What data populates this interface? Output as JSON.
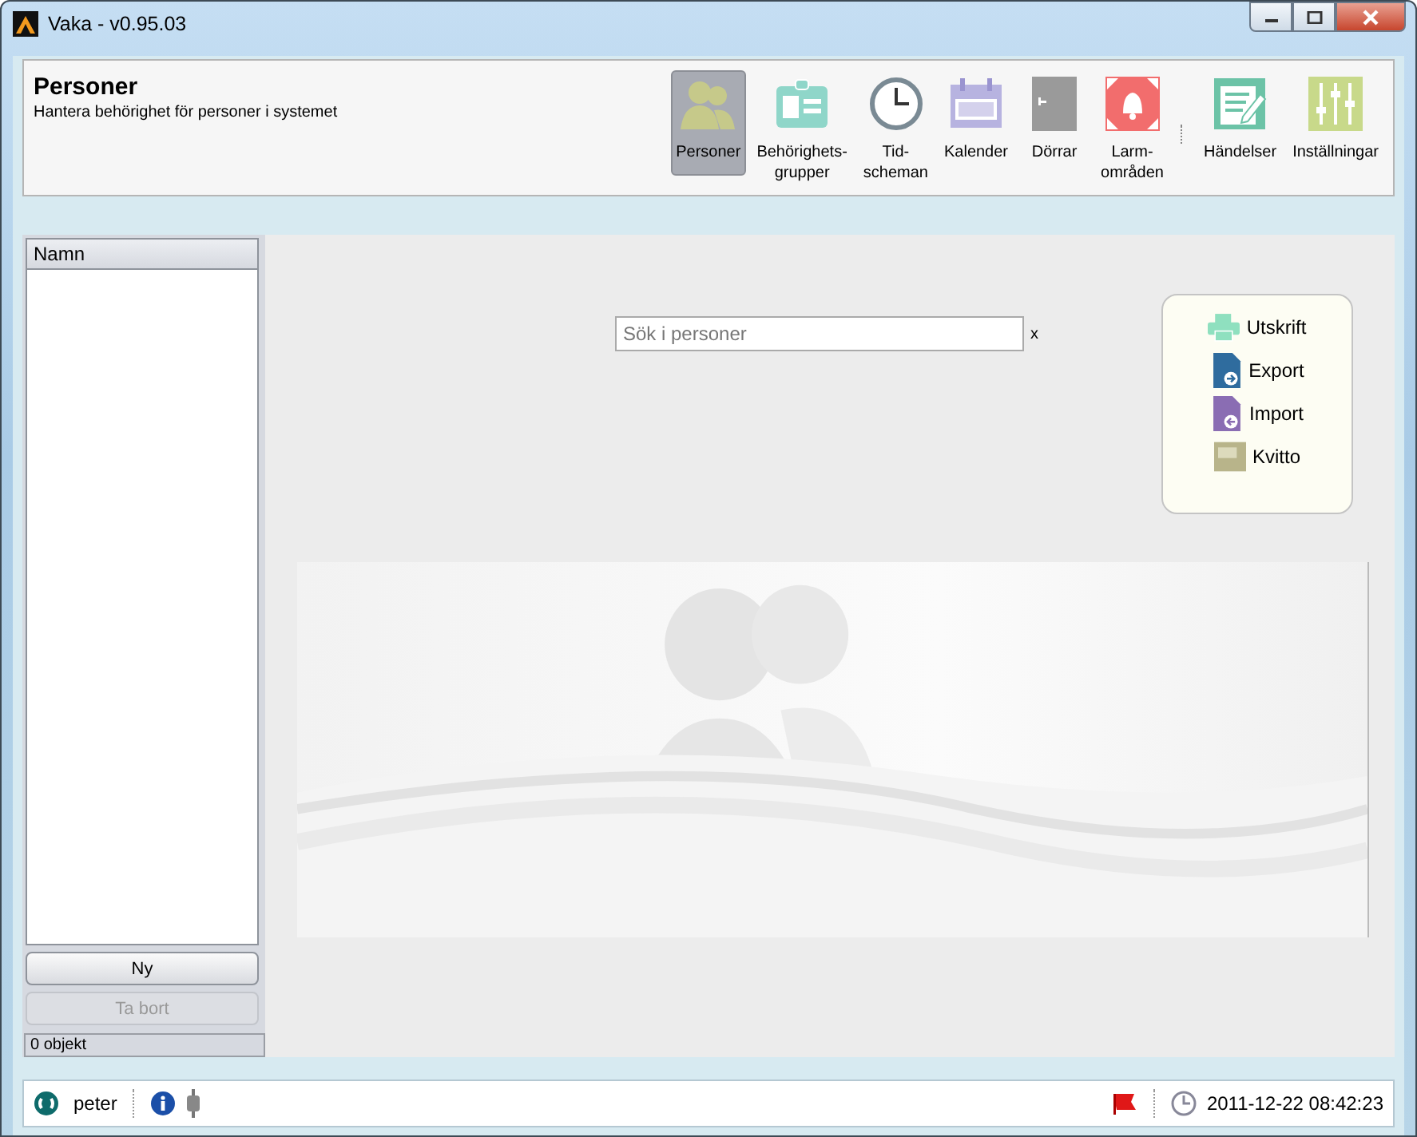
{
  "window": {
    "title": "Vaka - v0.95.03"
  },
  "header": {
    "title": "Personer",
    "subtitle": "Hantera behörighet för personer i systemet"
  },
  "toolbar": [
    {
      "label": "Personer",
      "kind": "people",
      "selected": true
    },
    {
      "label": "Behörighets-\ngrupper",
      "kind": "badge",
      "selected": false
    },
    {
      "label": "Tid-\nscheman",
      "kind": "clock",
      "selected": false
    },
    {
      "label": "Kalender",
      "kind": "calendar",
      "selected": false
    },
    {
      "label": "Dörrar",
      "kind": "door",
      "selected": false
    },
    {
      "label": "Larm-\nområden",
      "kind": "alarm",
      "selected": false
    },
    {
      "label": "Händelser",
      "kind": "events",
      "selected": false
    },
    {
      "label": "Inställningar",
      "kind": "settings",
      "selected": false
    }
  ],
  "list": {
    "column": "Namn",
    "buttons": [
      {
        "label": "Ny",
        "disabled": false
      },
      {
        "label": "Ta bort",
        "disabled": true
      }
    ],
    "count": "0 objekt"
  },
  "search": {
    "placeholder": "Sök i personer",
    "clear": "x"
  },
  "actions": [
    {
      "label": "Utskrift",
      "kind": "print"
    },
    {
      "label": "Export",
      "kind": "export"
    },
    {
      "label": "Import",
      "kind": "import"
    },
    {
      "label": "Kvitto",
      "kind": "receipt"
    }
  ],
  "status_bar": {
    "user": "peter",
    "datetime": "2011-12-22 08:42:23"
  }
}
